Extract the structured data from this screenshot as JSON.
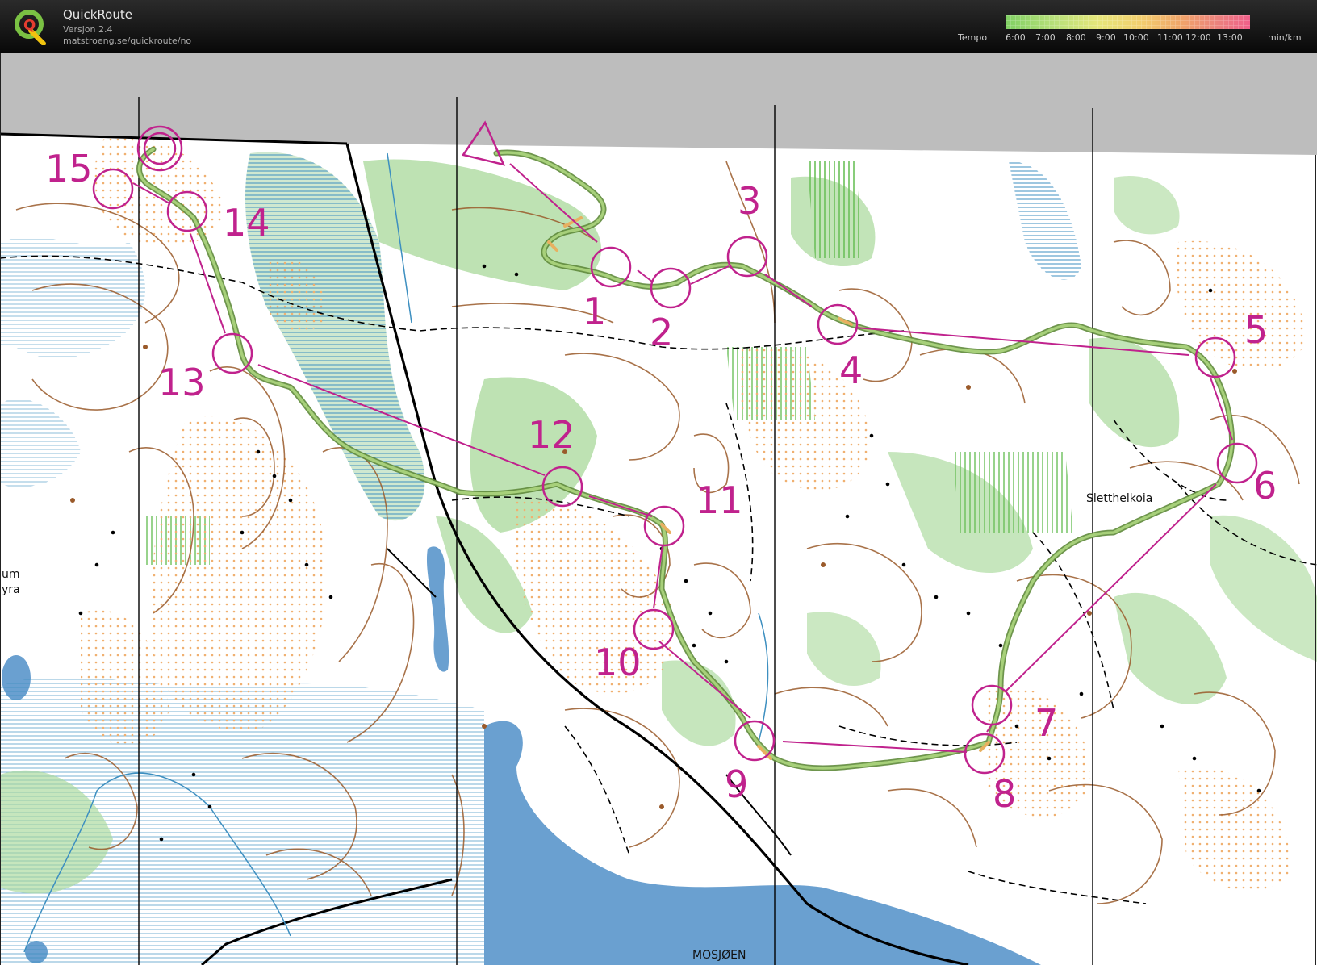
{
  "header": {
    "app_title": "QuickRoute",
    "version": "Versjon 2.4",
    "url": "matstroeng.se/quickroute/no",
    "logo_letter": "Q",
    "logo_icon": "quickroute-logo-icon"
  },
  "tempo_legend": {
    "label": "Tempo",
    "unit": "min/km",
    "ticks": [
      "6:00",
      "7:00",
      "8:00",
      "9:00",
      "10:00",
      "11:00",
      "12:00",
      "13:00"
    ],
    "gradient_colors": [
      "#7fcf63",
      "#b8e07a",
      "#e6e67a",
      "#f2cf6e",
      "#f0a46a",
      "#ec7f7f",
      "#f05f8a"
    ]
  },
  "map": {
    "place_names": [
      "Sletthelkoia",
      "MOSJØEN",
      "um",
      "yra"
    ],
    "control_labels": [
      "1",
      "2",
      "3",
      "4",
      "5",
      "6",
      "7",
      "8",
      "9",
      "10",
      "11",
      "12",
      "13",
      "14",
      "15"
    ],
    "colors": {
      "course": "#c0228d",
      "route": "#8dbf6a",
      "water": "#6aa0d0",
      "forest_green": "#a8d89a",
      "open_yellow": "#f3c98a",
      "contour": "#9a5a2a",
      "map_paper": "#ffffff",
      "out_of_map": "#bdbdbd"
    }
  }
}
